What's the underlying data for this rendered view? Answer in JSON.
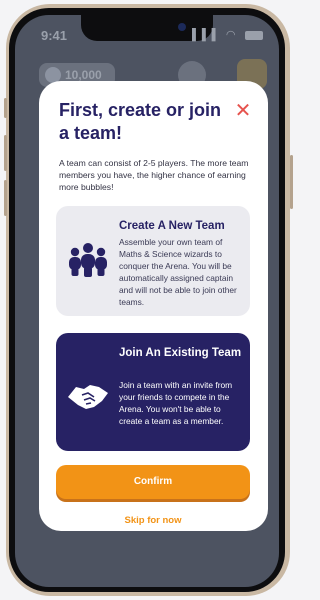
{
  "status_bar": {
    "time": "9:41",
    "signal": "▌▌▌ ◠"
  },
  "background": {
    "bubbles_count": "10,000"
  },
  "modal": {
    "title": "First, create or join a team!",
    "close_symbol": "✕",
    "description": "A team can consist of 2-5 players. The more team members you have, the higher chance of earning more bubbles!",
    "options": [
      {
        "title": "Create A New Team",
        "description": "Assemble your own team of Maths & Science wizards to conquer the Arena. You will be automatically assigned captain and will not be able to join other teams.",
        "icon": "team-group-icon",
        "selected": false
      },
      {
        "title": "Join An Existing Team",
        "description": "Join a team with an invite from your friends to compete in the Arena. You won't be able to create a team as a member.",
        "icon": "handshake-icon",
        "selected": true
      }
    ],
    "confirm_label": "Confirm",
    "skip_label": "Skip for now"
  },
  "colors": {
    "primary_navy": "#272264",
    "accent_orange": "#f29316",
    "close_red": "#e6534e",
    "card_light": "#ebebf0"
  }
}
